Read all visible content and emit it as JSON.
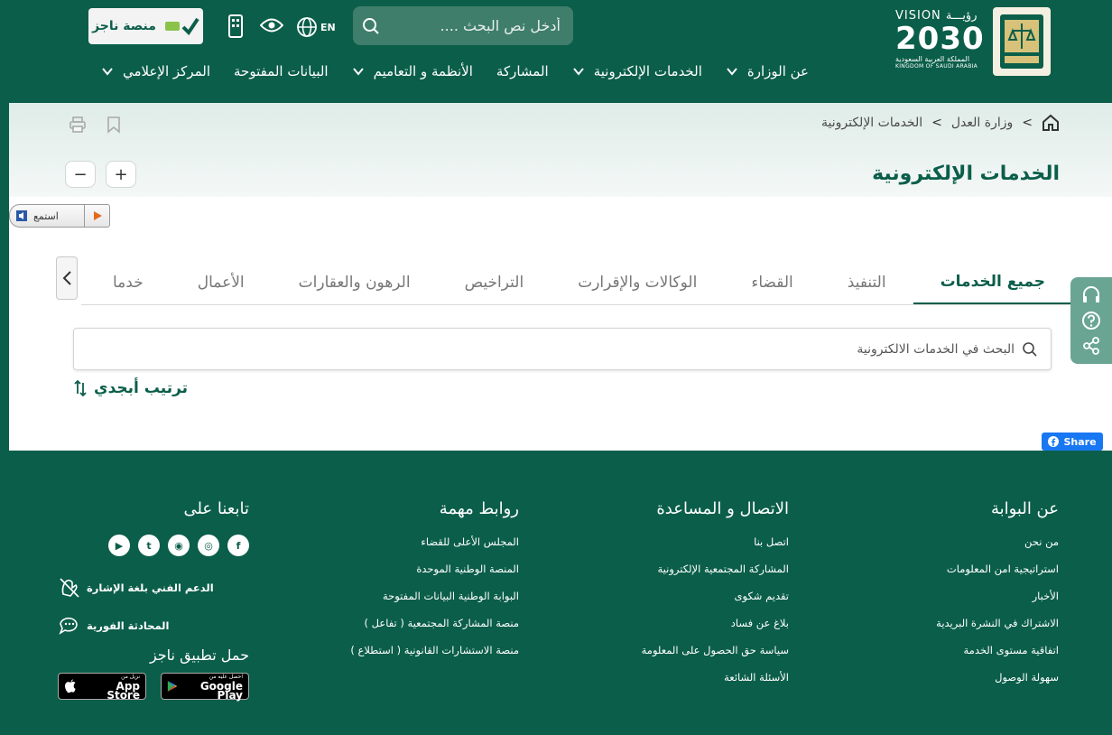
{
  "header": {
    "vision": {
      "top": "VISION",
      "arabic": "رؤيـــة",
      "year": "2030",
      "kingdom_ar": "المملكة العربية السعودية",
      "kingdom_en": "KINGDOM OF SAUDI ARABIA"
    },
    "search_placeholder": "أدخل نص البحث ....",
    "lang_label": "EN",
    "najiz_label": "منصة ناجز",
    "nav": [
      {
        "label": "عن الوزارة",
        "has_dropdown": true
      },
      {
        "label": "الخدمات الإلكترونية",
        "has_dropdown": true
      },
      {
        "label": "المشاركة",
        "has_dropdown": false
      },
      {
        "label": "الأنظمة و التعاميم",
        "has_dropdown": true
      },
      {
        "label": "البيانات المفتوحة",
        "has_dropdown": false
      },
      {
        "label": "المركز الإعلامي",
        "has_dropdown": true
      }
    ]
  },
  "breadcrumb": {
    "items": [
      "وزارة العدل",
      "الخدمات الإلكترونية"
    ],
    "sep": ">"
  },
  "page_title": "الخدمات الإلكترونية",
  "zoom": {
    "in": "+",
    "out": "−"
  },
  "listen_label": "استمع",
  "tabs": [
    {
      "label": "جميع الخدمات",
      "active": true
    },
    {
      "label": "التنفيذ",
      "active": false
    },
    {
      "label": "القضاء",
      "active": false
    },
    {
      "label": "الوكالات والإقرارت",
      "active": false
    },
    {
      "label": "التراخيص",
      "active": false
    },
    {
      "label": "الرهون والعقارات",
      "active": false
    },
    {
      "label": "الأعمال",
      "active": false
    },
    {
      "label": "خدما",
      "active": false
    }
  ],
  "service_search_placeholder": "البحث في الخدمات الالكترونية",
  "sort_label": "ترتيب أبجدي",
  "fb_share": "Share",
  "footer": {
    "portal": {
      "title": "عن البوابة",
      "links": [
        "من نحن",
        "استراتيجية امن المعلومات",
        "الأخبار",
        "الاشتراك في النشرة البريدية",
        "اتفاقية مستوى الخدمة",
        "سهولة الوصول"
      ]
    },
    "contact": {
      "title": "الاتصال و المساعدة",
      "links": [
        "اتصل بنا",
        "المشاركة المجتمعية الإلكترونية",
        "تقديم شكوى",
        "بلاغ عن فساد",
        "سياسة حق الحصول على المعلومة",
        "الأسئلة الشائعة"
      ]
    },
    "links": {
      "title": "روابط مهمة",
      "links": [
        "المجلس الأعلى للقضاء",
        "المنصة الوطنية الموحدة",
        "البوابة الوطنية البيانات المفتوحة",
        "منصة المشاركة المجتمعية ( تفاعل )",
        "منصة الاستشارات القانونية ( استطلاع )"
      ]
    },
    "follow": {
      "title": "تابعنا على",
      "social": [
        "youtube-icon",
        "twitter-icon",
        "snapchat-icon",
        "instagram-icon",
        "facebook-icon"
      ],
      "sign_support": "الدعم الفني بلغة الإشارة",
      "live_chat": "المحادثة الفورية",
      "app_title": "حمل تطبيق ناجز",
      "app_store_small": "نزيل من",
      "app_store": "App Store",
      "google_play_small": "احصل عليه من",
      "google_play": "Google Play"
    }
  }
}
